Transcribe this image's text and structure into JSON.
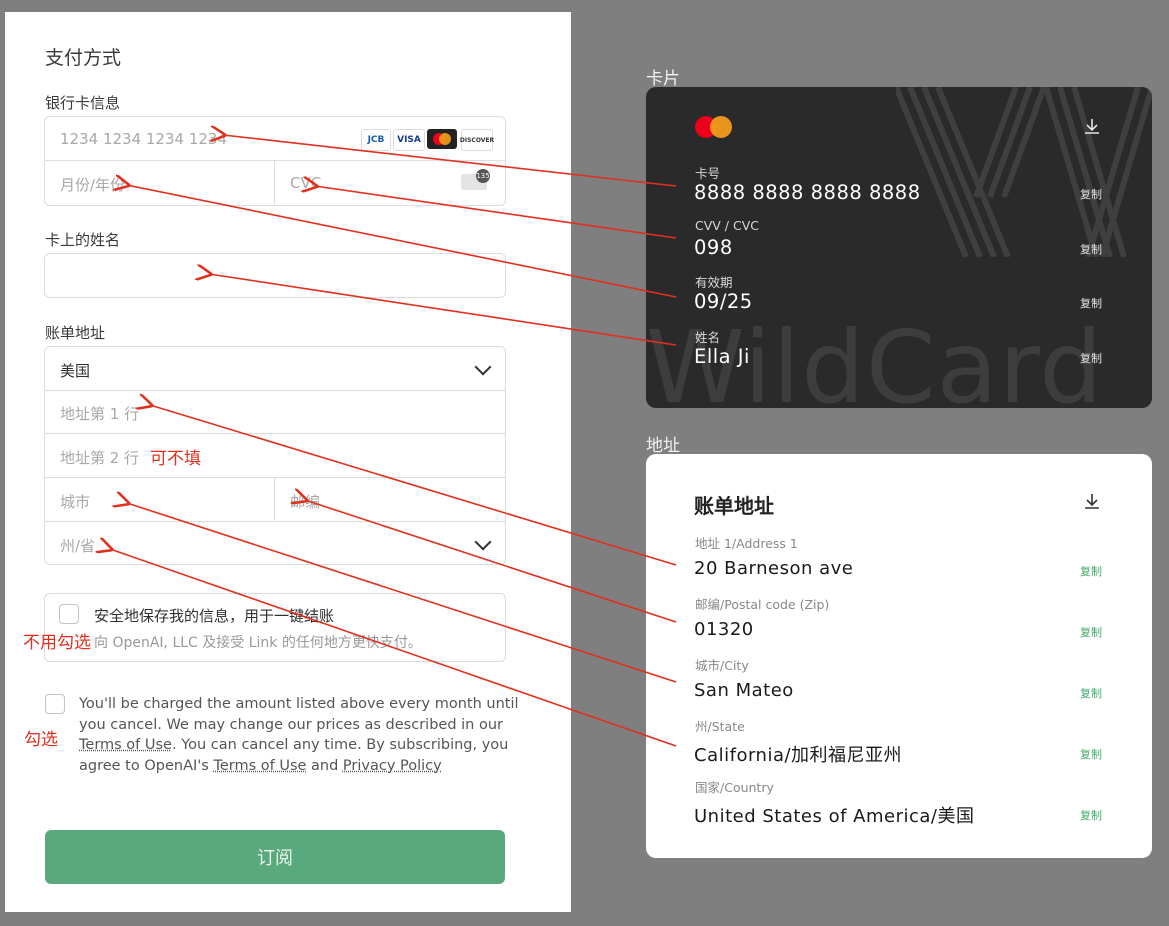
{
  "form": {
    "title": "支付方式",
    "card_section_label": "银行卡信息",
    "card_number_placeholder": "1234 1234 1234 1234",
    "card_brands": [
      "JCB",
      "VISA",
      "MC",
      "DISCOVER"
    ],
    "expiry_placeholder": "月份/年份",
    "cvc_placeholder": "CVC",
    "cvc_badge": "135",
    "name_section_label": "卡上的姓名",
    "name_value": "",
    "billing_section_label": "账单地址",
    "country_value": "美国",
    "address1_placeholder": "地址第 1 行",
    "address2_placeholder": "地址第 2 行",
    "city_placeholder": "城市",
    "zip_placeholder": "邮编",
    "state_placeholder": "州/省",
    "save_info_title": "安全地保存我的信息，用于一键结账",
    "save_info_sub": "向 OpenAI, LLC 及接受 Link 的任何地方更快支付。",
    "legal": {
      "p1": "You'll be charged the amount listed above every month until you cancel. We may change our prices as described in our ",
      "link1": "Terms of Use",
      "p2": ". You can cancel any time. By subscribing, you agree to OpenAI's ",
      "link2": "Terms of Use",
      "p3": " and ",
      "link3": "Privacy Policy"
    },
    "subscribe_label": "订阅"
  },
  "notes": {
    "optional": "可不填",
    "no_check": "不用勾选",
    "check": "勾选"
  },
  "card": {
    "section_label": "卡片",
    "watermark": "WildCard",
    "fields": [
      {
        "label": "卡号",
        "value": "8888 8888 8888 8888",
        "copy": "复制"
      },
      {
        "label": "CVV / CVC",
        "value": "098",
        "copy": "复制"
      },
      {
        "label": "有效期",
        "value": "09/25",
        "copy": "复制"
      },
      {
        "label": "姓名",
        "value": "Ella Ji",
        "copy": "复制"
      }
    ]
  },
  "address": {
    "section_label": "地址",
    "title": "账单地址",
    "fields": [
      {
        "label": "地址 1/Address 1",
        "value": "20 Barneson ave",
        "copy": "复制"
      },
      {
        "label": "邮编/Postal code (Zip)",
        "value": "01320",
        "copy": "复制"
      },
      {
        "label": "城市/City",
        "value": "San Mateo",
        "copy": "复制"
      },
      {
        "label": "州/State",
        "value": "California/加利福尼亚州",
        "copy": "复制"
      },
      {
        "label": "国家/Country",
        "value": "United States of America/美国",
        "copy": "复制"
      }
    ]
  },
  "colors": {
    "annotation": "#e0301e",
    "subscribe": "#5aa97c",
    "copy_green": "#43a86b",
    "card_bg": "#2a2a2a",
    "page_bg": "#7f7f7f"
  }
}
